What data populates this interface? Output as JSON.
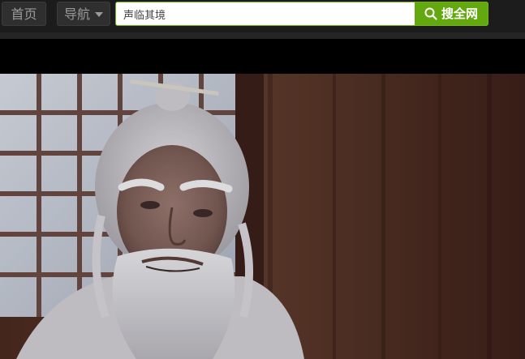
{
  "topbar": {
    "home_label": "首页",
    "nav_label": "导航",
    "search": {
      "value": "声临其境",
      "button_label": "搜全网"
    }
  },
  "colors": {
    "accent": "#64a80f",
    "topbar_bg": "#1c1c1c",
    "button_bg": "#2f2f2f"
  },
  "icons": [
    "chevron-down-icon",
    "search-icon"
  ]
}
